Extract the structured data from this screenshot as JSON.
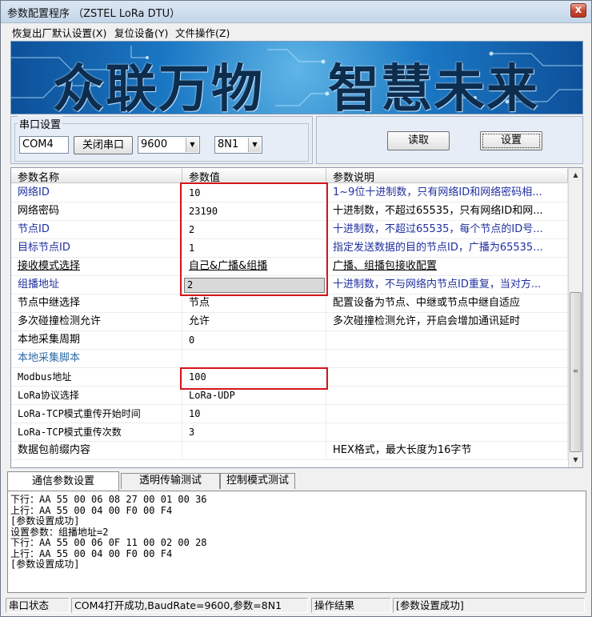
{
  "window": {
    "title": "参数配置程序  （ZSTEL LoRa DTU）",
    "close_glyph": "x"
  },
  "menu": [
    {
      "label": "恢复出厂默认设置(X)"
    },
    {
      "label": "复位设备(Y)"
    },
    {
      "label": "文件操作(Z)"
    }
  ],
  "banner": {
    "slogan_left": "众联万物",
    "slogan_right": "智慧未来"
  },
  "serial": {
    "group_label": "串口设置",
    "port": "COM4",
    "close_port_button": "关闭串口",
    "baud": "9600",
    "format": "8N1"
  },
  "actions": {
    "read_button": "读取",
    "set_button": "设置"
  },
  "grid": {
    "headers": [
      "参数名称",
      "参数值",
      "参数说明"
    ],
    "rows": [
      {
        "name": "网络ID",
        "value": "10",
        "desc": "1~9位十进制数，只有网络ID和网络密码相...",
        "blue": true
      },
      {
        "name": "网络密码",
        "value": "23190",
        "desc": "十进制数，不超过65535，只有网络ID和网...",
        "blue": false
      },
      {
        "name": "节点ID",
        "value": "2",
        "desc": "十进制数，不超过65535，每个节点的ID号...",
        "blue": true
      },
      {
        "name": "目标节点ID",
        "value": "1",
        "desc": "指定发送数据的目的节点ID，广播为65535...",
        "blue": true
      },
      {
        "name": "接收模式选择",
        "value": "自己&广播&组播",
        "desc": "广播、组播包接收配置",
        "blue": false
      },
      {
        "name": "组播地址",
        "value": "2",
        "desc": "十进制数，不与网络内节点ID重复，当对方...",
        "blue": true
      },
      {
        "name": "节点中继选择",
        "value": "节点",
        "desc": "配置设备为节点、中继或节点中继自适应",
        "blue": false
      },
      {
        "name": "多次碰撞检测允许",
        "value": "允许",
        "desc": "多次碰撞检测允许，开启会增加通讯延时",
        "blue": false
      },
      {
        "name": "本地采集周期",
        "value": "0",
        "desc": "",
        "blue": false
      },
      {
        "name": "本地采集脚本",
        "value": "",
        "desc": "",
        "blue": true
      },
      {
        "name": "Modbus地址",
        "value": "100",
        "desc": "",
        "blue": false
      },
      {
        "name": "LoRa协议选择",
        "value": "LoRa-UDP",
        "desc": "",
        "blue": false
      },
      {
        "name": "LoRa-TCP模式重传开始时间",
        "value": "10",
        "desc": "",
        "blue": false
      },
      {
        "name": "LoRa-TCP模式重传次数",
        "value": "3",
        "desc": "",
        "blue": false
      },
      {
        "name": "数据包前缀内容",
        "value": "",
        "desc": "HEX格式，最大长度为16字节",
        "blue": false
      }
    ]
  },
  "tabs": [
    {
      "label": "通信参数设置",
      "active": true
    },
    {
      "label": "透明传输测试",
      "active": false
    },
    {
      "label": "控制模式测试",
      "active": false
    }
  ],
  "log": [
    "下行：AA 55 00 06 08 27 00 01 00 36",
    "上行：AA 55 00 04 00 F0 00 F4",
    "[参数设置成功]",
    "设置参数：组播地址=2",
    "下行：AA 55 00 06 0F 11 00 02 00 28",
    "上行：AA 55 00 04 00 F0 00 F4",
    "[参数设置成功]"
  ],
  "status": {
    "label": "串口状态",
    "port_status": "COM4打开成功,BaudRate=9600,参数=8N1",
    "result_label": "操作结果",
    "result": "[参数设置成功]"
  },
  "icons": [
    "close-icon",
    "dropdown-arrow-icon",
    "scroll-up-icon",
    "scroll-down-icon"
  ]
}
